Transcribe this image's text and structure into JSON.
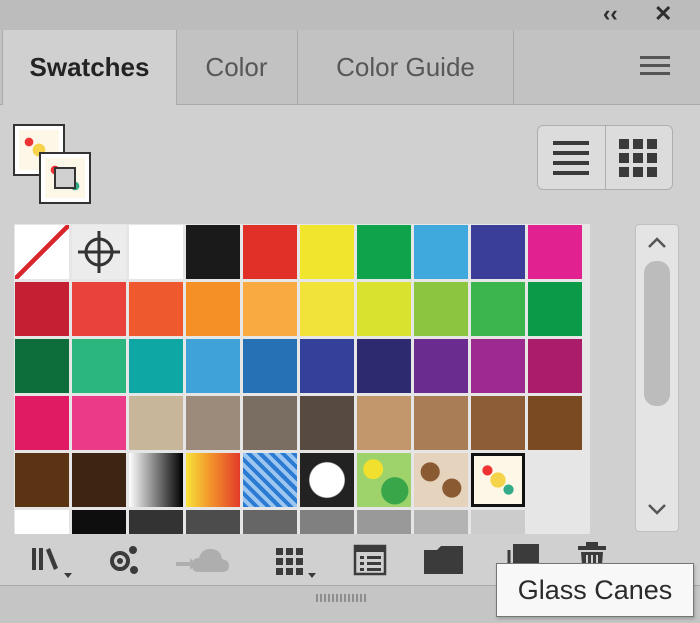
{
  "tabs": [
    {
      "label": "Swatches",
      "active": true
    },
    {
      "label": "Color",
      "active": false
    },
    {
      "label": "Color Guide",
      "active": false
    }
  ],
  "window_controls": {
    "collapse_glyph": "‹‹",
    "close_glyph": "✕"
  },
  "icons": {
    "menu": "panel-menu-icon",
    "list_view": "list-view-icon",
    "thumb_view": "thumbnail-view-icon",
    "library": "swatch-libraries-icon",
    "link": "link-swatch-icon",
    "cloud": "cloud-library-icon",
    "swatch_kinds": "show-swatch-kinds-icon",
    "options": "swatch-options-icon",
    "new_group": "new-color-group-icon",
    "new_swatch": "new-swatch-icon",
    "delete": "delete-swatch-icon"
  },
  "swatch_rows": [
    [
      "none",
      "registration",
      "#ffffff",
      "#1a1a1a",
      "#e03027",
      "#f2e52e",
      "#0fa34c",
      "#3fa8dd",
      "#3a3e99",
      "#e0218f"
    ],
    [
      "#c51f34",
      "#e8423b",
      "#ee5a2d",
      "#f59026",
      "#f9ab42",
      "#f2e33b",
      "#d8e22f",
      "#8cc540",
      "#3cb54c",
      "#0b9a48"
    ],
    [
      "#0e6e3b",
      "#2ab67d",
      "#0fa7a3",
      "#3fa3d9",
      "#2670b5",
      "#33419a",
      "#2d2a70",
      "#6a2c8f",
      "#9d2a8e",
      "#ab1c6a"
    ],
    [
      "#e11b63",
      "#eb3b88",
      "#c8b69a",
      "#9c8a7a",
      "#7a6e63",
      "#574a40",
      "#c3976c",
      "#a97d56",
      "#8d5d38",
      "#7a4a22"
    ],
    [
      "#5a3413",
      "#3e2412",
      "gradient-bw",
      "gradient-fire",
      "pattern-blue",
      "pattern-circle",
      "pattern-green",
      "pattern-brown",
      "glass-canes"
    ]
  ],
  "tooltip": "Glass Canes",
  "colors": {
    "panel_bg": "#d0d0d0",
    "tab_bg": "#c2c2c2",
    "tooltip_bg": "#f8f8f8"
  }
}
